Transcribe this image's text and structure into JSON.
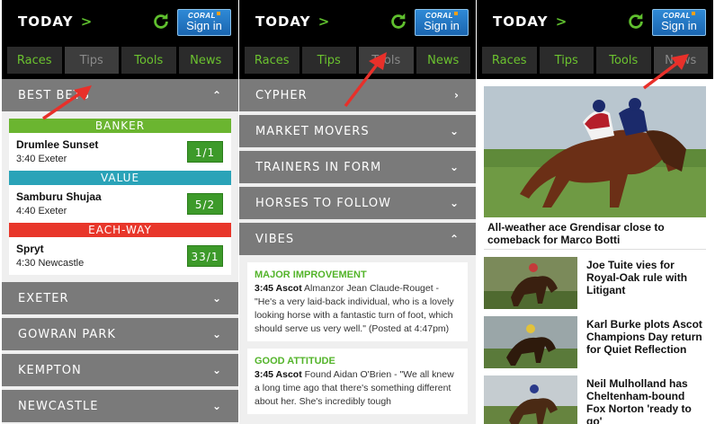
{
  "header": {
    "today_label": "TODAY",
    "chevron": ">",
    "signin_brand": "CORAL",
    "signin_label": "Sign in"
  },
  "tabs": [
    "Races",
    "Tips",
    "Tools",
    "News"
  ],
  "panels": [
    {
      "active_tab": "Tips"
    },
    {
      "active_tab": "Tools"
    },
    {
      "active_tab": "News"
    }
  ],
  "tips_panel": {
    "section_title": "BEST BETS",
    "categories": [
      {
        "label": "BANKER",
        "color": "#6bb530",
        "horse": "Drumlee Sunset",
        "race": "3:40 Exeter",
        "odds": "1/1"
      },
      {
        "label": "VALUE",
        "color": "#2aa3b8",
        "horse": "Samburu Shujaa",
        "race": "4:40 Exeter",
        "odds": "5/2"
      },
      {
        "label": "EACH-WAY",
        "color": "#e8362a",
        "horse": "Spryt",
        "race": "4:30 Newcastle",
        "odds": "33/1"
      }
    ],
    "courses": [
      "EXETER",
      "GOWRAN PARK",
      "KEMPTON",
      "NEWCASTLE"
    ]
  },
  "tools_panel": {
    "items": [
      "CYPHER",
      "MARKET MOVERS",
      "TRAINERS IN FORM",
      "HORSES TO FOLLOW",
      "VIBES"
    ],
    "vibes": [
      {
        "title": "MAJOR IMPROVEMENT",
        "time_course": "3:45 Ascot",
        "text": " Almanzor Jean Claude-Rouget - \"He's a very laid-back individual, who is a lovely looking horse with a fantastic turn of foot, which should serve us very well.\" (Posted at 4:47pm)"
      },
      {
        "title": "GOOD ATTITUDE",
        "time_course": "3:45 Ascot",
        "text": " Found Aidan O'Brien - \"We all knew a long time ago that there's something different about her. She's incredibly tough"
      }
    ]
  },
  "news_panel": {
    "hero_headline": "All-weather ace Grendisar close to comeback for Marco Botti",
    "articles": [
      "Joe Tuite vies for Royal-Oak rule with Litigant",
      "Karl Burke plots Ascot Champions Day return for Quiet Reflection",
      "Neil Mulholland has Cheltenham-bound Fox Norton 'ready to go'"
    ]
  },
  "colors": {
    "accent_green": "#5fbf2e",
    "annotation_red": "#e8302a",
    "accordion_grey": "#7a7a7a"
  }
}
